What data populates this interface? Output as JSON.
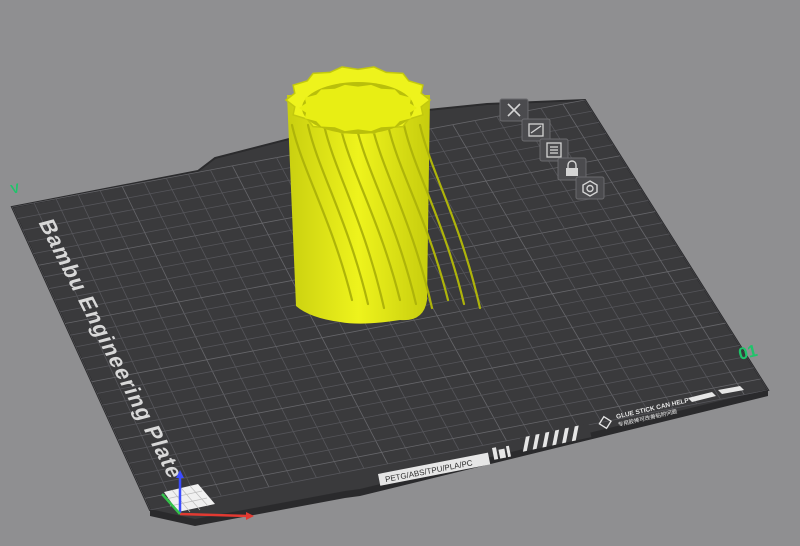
{
  "viewport": {
    "background_color": "#8f8f91",
    "plate": {
      "label": "Bambu Engineering Plate",
      "plate_number": "01",
      "corner_mark": "V",
      "filament_text": "PETG/ABS/TPU/PLA/PC",
      "glue_notice": "GLUE STICK CAN HELP",
      "glue_notice_cn": "专用胶棒可改善粘附问题",
      "surface_color": "#3a3a3c",
      "grid_color": "#57575a",
      "accent_color": "#1fc46a"
    },
    "model": {
      "name": "twisted-vase",
      "color": "#e8ee14"
    },
    "plate_toolbar": [
      {
        "name": "delete-plate-button",
        "icon": "close-icon"
      },
      {
        "name": "arrange-plate-button",
        "icon": "arrange-icon"
      },
      {
        "name": "plate-settings-button",
        "icon": "list-icon"
      },
      {
        "name": "lock-plate-button",
        "icon": "lock-icon"
      },
      {
        "name": "orient-plate-button",
        "icon": "gear-icon"
      }
    ]
  }
}
